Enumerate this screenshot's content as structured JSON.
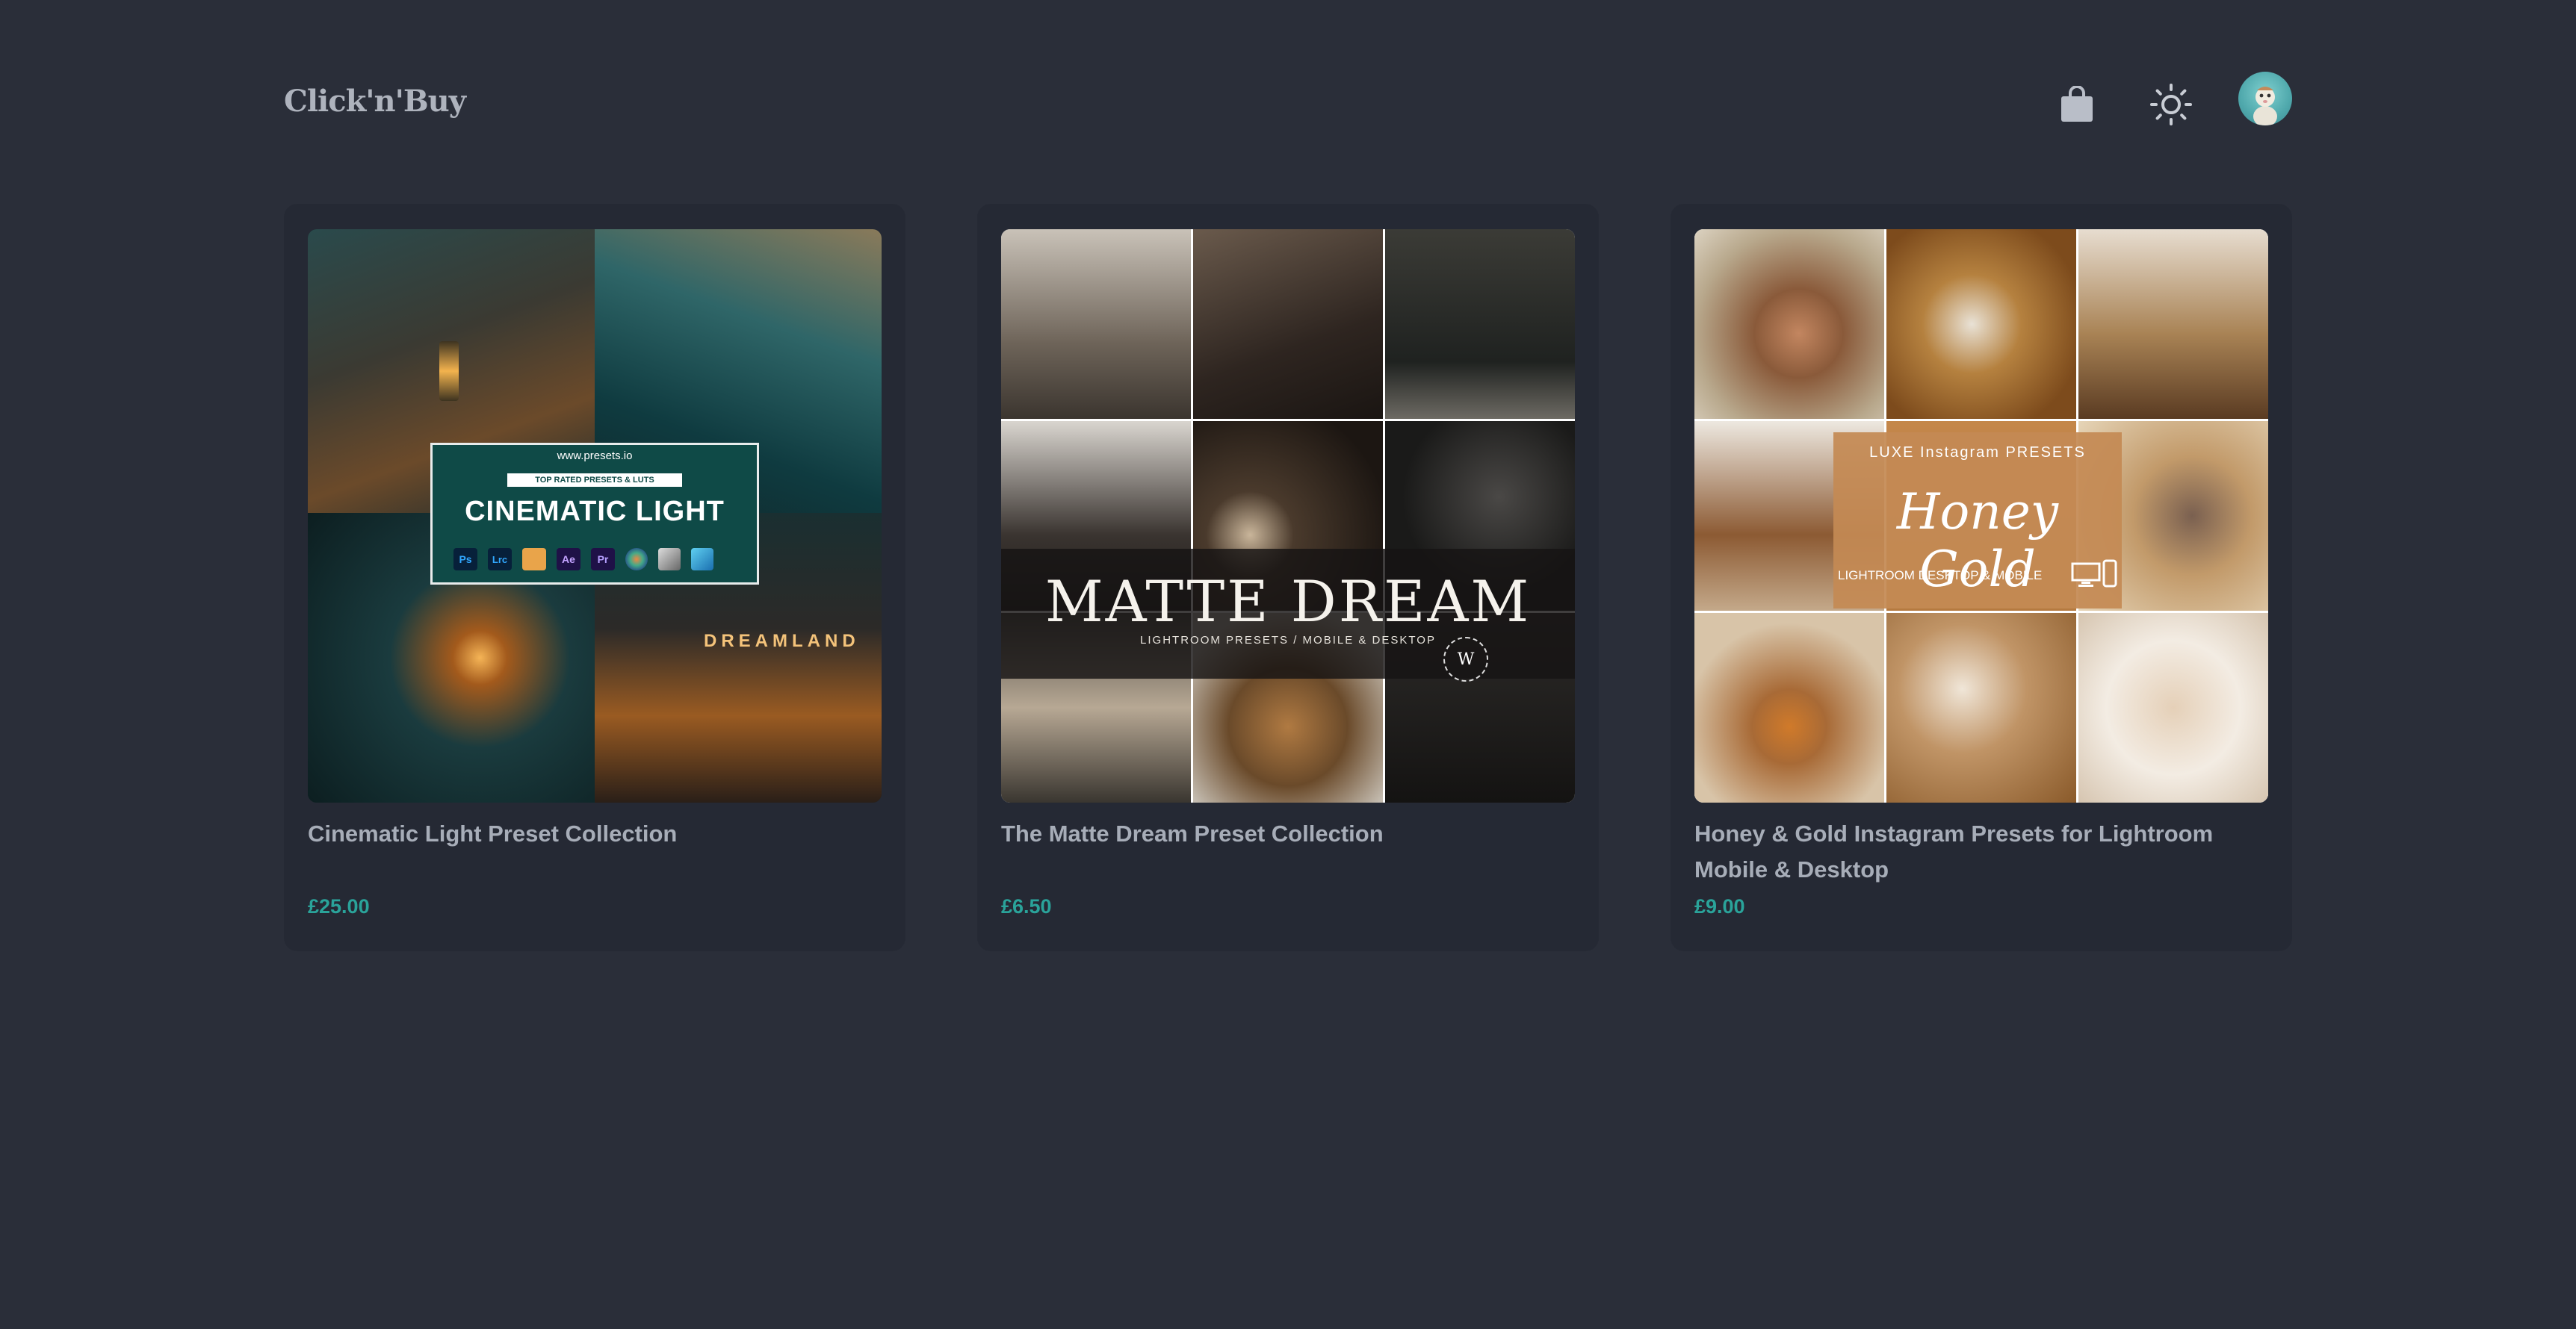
{
  "header": {
    "logo": "Click'n'Buy",
    "cart_icon": "shopping-bag-icon",
    "theme_icon": "sun-icon",
    "avatar_icon": "user-avatar"
  },
  "colors": {
    "background": "#2a2e39",
    "card": "#252934",
    "price": "#2aa39a",
    "title": "#a7adb8"
  },
  "products": [
    {
      "title": "Cinematic Light Preset Collection",
      "price": "£25.00",
      "image": {
        "site": "www.presets.io",
        "badge": "TOP RATED PRESETS & LUTS",
        "headline": "CINEMATIC LIGHT",
        "apps": [
          "Ps",
          "Lrc",
          "Ae",
          "Pr"
        ],
        "sign": "DREAMLAND"
      }
    },
    {
      "title": "The Matte Dream Preset Collection",
      "price": "£6.50",
      "image": {
        "headline": "MATTE DREAM",
        "subline": "LIGHTROOM PRESETS / MOBILE & DESKTOP",
        "seal": "W"
      }
    },
    {
      "title": "Honey & Gold Instagram Presets for Lightroom Mobile & Desktop",
      "price": "£9.00",
      "image": {
        "kicker": "LUXE Instagram PRESETS",
        "headline": "Honey Gold",
        "subline": "LIGHTROOM DESKTOP & MOBILE"
      }
    }
  ]
}
